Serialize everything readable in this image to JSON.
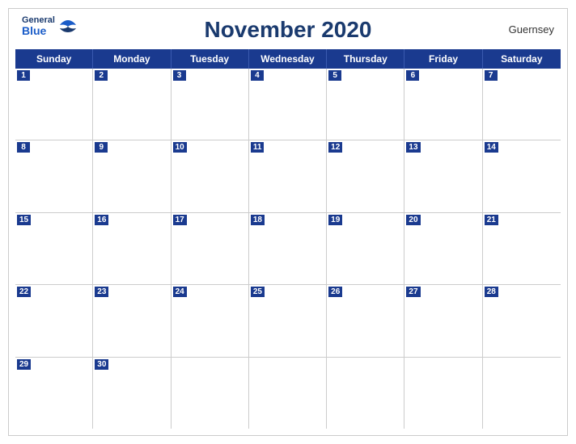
{
  "header": {
    "logo_general": "General",
    "logo_blue": "Blue",
    "title": "November 2020",
    "country": "Guernsey"
  },
  "days_of_week": [
    "Sunday",
    "Monday",
    "Tuesday",
    "Wednesday",
    "Thursday",
    "Friday",
    "Saturday"
  ],
  "weeks": [
    [
      1,
      2,
      3,
      4,
      5,
      6,
      7
    ],
    [
      8,
      9,
      10,
      11,
      12,
      13,
      14
    ],
    [
      15,
      16,
      17,
      18,
      19,
      20,
      21
    ],
    [
      22,
      23,
      24,
      25,
      26,
      27,
      28
    ],
    [
      29,
      30,
      null,
      null,
      null,
      null,
      null
    ]
  ],
  "accent_color": "#1a3a8f"
}
